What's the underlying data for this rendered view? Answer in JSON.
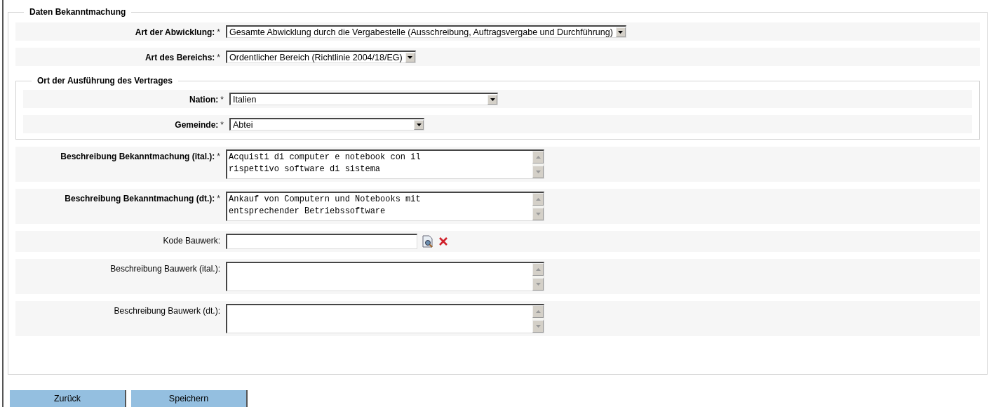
{
  "section": {
    "legend": "Daten Bekanntmachung",
    "fields_top": [
      {
        "kind": "select",
        "label": "Art der Abwicklung:",
        "required": true,
        "required_mark": "*",
        "value": "Gesamte Abwicklung durch die Vergabestelle (Ausschreibung, Auftragsvergabe und Durchführung)"
      },
      {
        "kind": "select",
        "label": "Art des Bereichs:",
        "required": true,
        "required_mark": "*",
        "value": "Ordentlicher Bereich (Richtlinie 2004/18/EG)"
      }
    ],
    "subsection": {
      "legend": "Ort der Ausführung des Vertrages",
      "fields": [
        {
          "kind": "select",
          "label": "Nation:",
          "required": true,
          "required_mark": "*",
          "value": "Italien"
        },
        {
          "kind": "select",
          "label": "Gemeinde:",
          "required": true,
          "required_mark": "*",
          "value": "Abtei"
        }
      ]
    },
    "fields_bottom": [
      {
        "kind": "textarea",
        "label": "Beschreibung Bekanntmachung (ital.):",
        "required": true,
        "required_mark": "*",
        "value": "Acquisti di computer e notebook con il\nrispettivo software di sistema"
      },
      {
        "kind": "textarea",
        "label": "Beschreibung Bekanntmachung (dt.):",
        "required": true,
        "required_mark": "*",
        "value": "Ankauf von Computern und Notebooks mit\nentsprechender Betriebssoftware"
      },
      {
        "kind": "lookup",
        "label": "Kode Bauwerk:",
        "required": false
      },
      {
        "kind": "textarea",
        "label": "Beschreibung Bauwerk (ital.):",
        "required": false
      },
      {
        "kind": "textarea",
        "label": "Beschreibung Bauwerk (dt.):",
        "required": false
      }
    ]
  },
  "buttons": [
    "Zurück",
    "Speichern"
  ]
}
